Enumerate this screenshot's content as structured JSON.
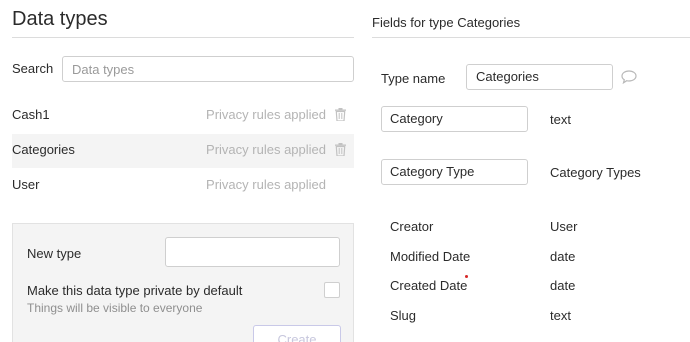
{
  "data_types_panel": {
    "title": "Data types",
    "search": {
      "label": "Search",
      "placeholder": "Data types",
      "value": ""
    },
    "types": [
      {
        "name": "Cash1",
        "privacy": "Privacy rules applied",
        "deletable": true,
        "selected": false
      },
      {
        "name": "Categories",
        "privacy": "Privacy rules applied",
        "deletable": true,
        "selected": true
      },
      {
        "name": "User",
        "privacy": "Privacy rules applied",
        "deletable": false,
        "selected": false
      }
    ],
    "new_type": {
      "label": "New type",
      "value": "",
      "private_label": "Make this data type private by default",
      "private_sub": "Things will be visible to everyone",
      "private_checked": false,
      "create_label": "Create"
    }
  },
  "fields_panel": {
    "title": "Fields for type Categories",
    "type_name_label": "Type name",
    "type_name_value": "Categories",
    "custom_fields": [
      {
        "name": "Category",
        "type": "text"
      },
      {
        "name": "Category Type",
        "type": "Category Types"
      }
    ],
    "builtin_fields": [
      {
        "name": "Creator",
        "type": "User"
      },
      {
        "name": "Modified Date",
        "type": "date"
      },
      {
        "name": "Created Date",
        "type": "date"
      },
      {
        "name": "Slug",
        "type": "text"
      }
    ]
  },
  "icons": {
    "trash": "trash-icon",
    "comment": "speech-bubble-icon"
  }
}
